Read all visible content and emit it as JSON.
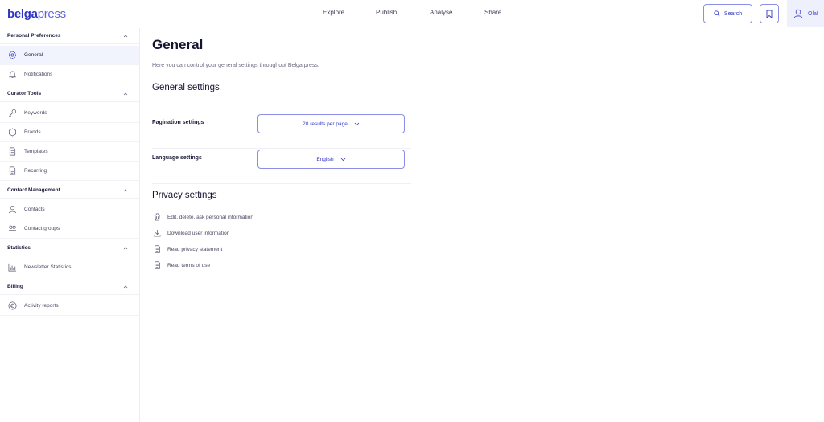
{
  "header": {
    "logo": {
      "belga": "belga",
      "press": "press"
    },
    "nav": [
      "Explore",
      "Publish",
      "Analyse",
      "Share"
    ],
    "search_label": "Search",
    "user_name": "Olaf"
  },
  "sidebar": {
    "sections": [
      {
        "title": "Personal Preferences",
        "items": [
          {
            "label": "General",
            "icon": "gear-icon",
            "active": true
          },
          {
            "label": "Notifications",
            "icon": "bell-icon"
          }
        ]
      },
      {
        "title": "Curator Tools",
        "items": [
          {
            "label": "Keywords",
            "icon": "key-icon"
          },
          {
            "label": "Brands",
            "icon": "hexagon-icon"
          },
          {
            "label": "Templates",
            "icon": "document-icon"
          },
          {
            "label": "Recurring",
            "icon": "document-icon"
          }
        ]
      },
      {
        "title": "Contact Management",
        "items": [
          {
            "label": "Contacts",
            "icon": "user-icon"
          },
          {
            "label": "Contact groups",
            "icon": "users-icon"
          }
        ]
      },
      {
        "title": "Statistics",
        "items": [
          {
            "label": "Newsletter Statistics",
            "icon": "bar-chart-icon"
          }
        ]
      },
      {
        "title": "Billing",
        "items": [
          {
            "label": "Activity reports",
            "icon": "euro-icon"
          }
        ]
      }
    ]
  },
  "main": {
    "title": "General",
    "description": "Here you can control your general settings throughout Belga.press.",
    "general_settings_heading": "General settings",
    "pagination": {
      "label": "Pagination settings",
      "value": "20 results per page"
    },
    "language": {
      "label": "Language settings",
      "value": "English"
    },
    "privacy_heading": "Privacy settings",
    "privacy_items": [
      {
        "label": "Edit, delete, ask personal information",
        "icon": "trash-icon"
      },
      {
        "label": "Download user information",
        "icon": "download-icon"
      },
      {
        "label": "Read privacy statement",
        "icon": "document-icon"
      },
      {
        "label": "Read terms of use",
        "icon": "document-icon"
      }
    ]
  },
  "colors": {
    "accent": "#3237c3",
    "border": "#8a8ee6",
    "active_bg": "#f1f3fd"
  }
}
